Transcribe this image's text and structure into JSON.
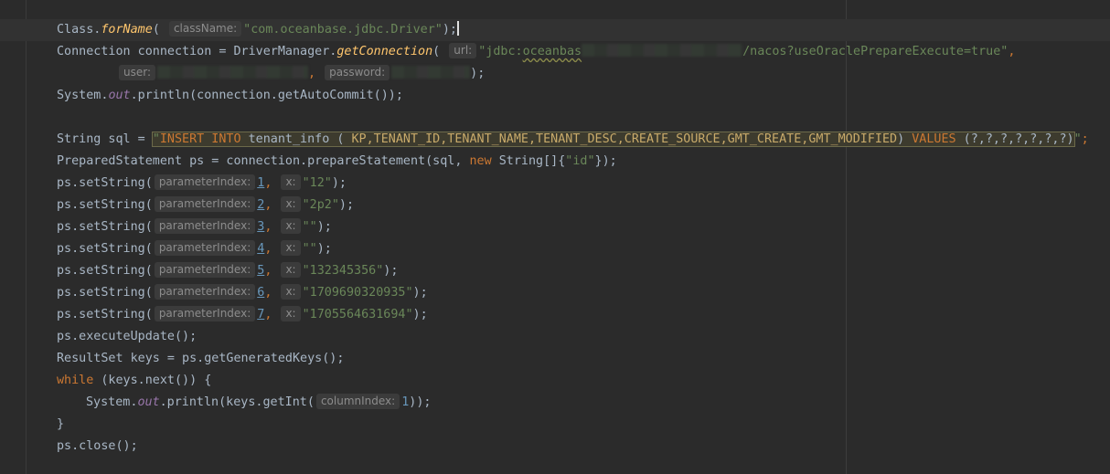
{
  "code": {
    "l1": {
      "a": "Class.",
      "method": "forName",
      "paren": "( ",
      "hint": "className:",
      "str": "\"com.oceanbase.jdbc.Driver\"",
      "end": ");"
    },
    "l2": {
      "a": "Connection connection = DriverManager.",
      "method": "getConnection",
      "paren": "( ",
      "hint": "url:",
      "str_a": "\"jdbc:",
      "str_b": "oceanbas",
      "str_c": "/nacos?useOraclePrepareExecute=true\"",
      "end": ","
    },
    "l3": {
      "hint_user": "user:",
      "comma": ",",
      "hint_pass": "password:",
      "end": ");"
    },
    "l4": {
      "a": "System.",
      "field": "out",
      "b": ".println(connection.getAutoCommit());"
    },
    "l5": {
      "a": "String sql = ",
      "q1": "\"",
      "insert": "INSERT INTO",
      "table": " tenant_info ( ",
      "cols": "KP,TENANT_ID,TENANT_NAME,TENANT_DESC,CREATE_SOURCE,GMT_CREATE,GMT_MODIFIED",
      "close": ") ",
      "values": "VALUES",
      "params": " (?,?,?,?,?,?,?)",
      "q2": "\"",
      "end": ";"
    },
    "l6": {
      "a": "PreparedStatement ps = connection.prepareStatement(sql, ",
      "kw": "new",
      "b": " String[]{",
      "str": "\"id\"",
      "end": "});"
    },
    "setstrings": [
      {
        "a": "ps.setString(",
        "hint1": "parameterIndex:",
        "idx": "1",
        "comma": ", ",
        "hint2": "x:",
        "val": "\"12\"",
        "end": ");"
      },
      {
        "a": "ps.setString(",
        "hint1": "parameterIndex:",
        "idx": "2",
        "comma": ", ",
        "hint2": "x:",
        "val": "\"2p2\"",
        "end": ");"
      },
      {
        "a": "ps.setString(",
        "hint1": "parameterIndex:",
        "idx": "3",
        "comma": ", ",
        "hint2": "x:",
        "val": "\"\"",
        "end": ");"
      },
      {
        "a": "ps.setString(",
        "hint1": "parameterIndex:",
        "idx": "4",
        "comma": ", ",
        "hint2": "x:",
        "val": "\"\"",
        "end": ");"
      },
      {
        "a": "ps.setString(",
        "hint1": "parameterIndex:",
        "idx": "5",
        "comma": ", ",
        "hint2": "x:",
        "val": "\"132345356\"",
        "end": ");"
      },
      {
        "a": "ps.setString(",
        "hint1": "parameterIndex:",
        "idx": "6",
        "comma": ", ",
        "hint2": "x:",
        "val": "\"1709690320935\"",
        "end": ");"
      },
      {
        "a": "ps.setString(",
        "hint1": "parameterIndex:",
        "idx": "7",
        "comma": ", ",
        "hint2": "x:",
        "val": "\"1705564631694\"",
        "end": ");"
      }
    ],
    "l14": "ps.executeUpdate();",
    "l15": "ResultSet keys = ps.getGeneratedKeys();",
    "l16": {
      "kw": "while",
      "b": " (keys.next()) {"
    },
    "l17": {
      "a": "System.",
      "field": "out",
      "b": ".println(keys.getInt(",
      "hint": "columnIndex:",
      "num": "1",
      "end": "));"
    },
    "l18": "}",
    "l19": "ps.close();"
  },
  "colors": {
    "background": "#2b2b2b",
    "string": "#6a8759",
    "keyword": "#cc7832",
    "method": "#ffc66d",
    "number": "#6897bb",
    "hint_bg": "#3b3b3b"
  }
}
